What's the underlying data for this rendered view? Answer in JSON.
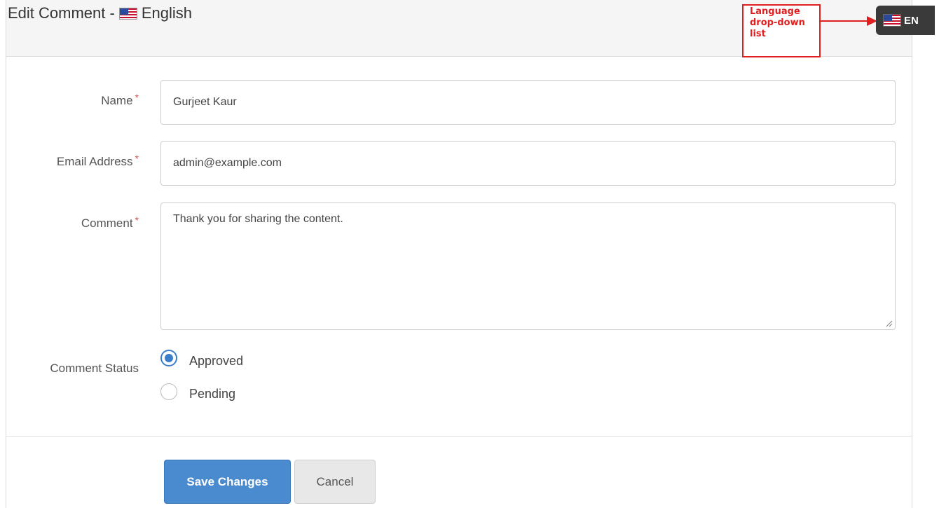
{
  "header": {
    "title_prefix": "Edit Comment -",
    "title_language": "English"
  },
  "language_selector": {
    "code": "EN",
    "flag_icon": "us-flag-icon"
  },
  "annotation": {
    "line1": "Language",
    "line2": "drop-down",
    "line3": "list",
    "color": "#e02020"
  },
  "form": {
    "name": {
      "label": "Name",
      "required_mark": "*",
      "value": "Gurjeet Kaur"
    },
    "email": {
      "label": "Email Address",
      "required_mark": "*",
      "value": "admin@example.com"
    },
    "comment": {
      "label": "Comment",
      "required_mark": "*",
      "value": "Thank you for sharing the content."
    },
    "status": {
      "label": "Comment Status",
      "options": [
        {
          "label": "Approved",
          "checked": true
        },
        {
          "label": "Pending",
          "checked": false
        }
      ]
    }
  },
  "actions": {
    "save_label": "Save Changes",
    "cancel_label": "Cancel"
  },
  "colors": {
    "primary": "#4a8bd0",
    "required": "#d9534f",
    "annotation": "#e02020"
  }
}
